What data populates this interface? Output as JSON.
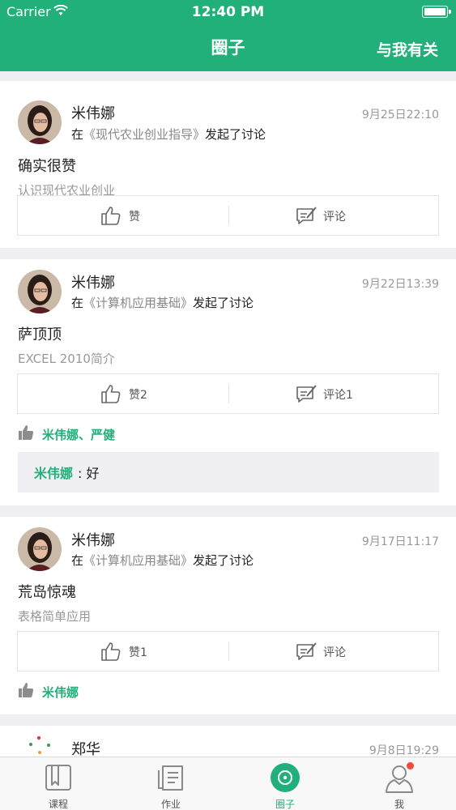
{
  "status_bar": {
    "carrier": "Carrier",
    "time": "12:40 PM"
  },
  "nav": {
    "title": "圈子",
    "right_label": "与我有关"
  },
  "colors": {
    "accent": "#22b07a",
    "badge": "#f44b3c",
    "background": "#efeff4"
  },
  "posts": [
    {
      "author": "米伟娜",
      "time": "9月25日22:10",
      "desc_prefix": "在",
      "course": "《现代农业创业指导》",
      "desc_suffix": "发起了讨论",
      "title": "确实很赞",
      "subtitle": "认识现代农业创业",
      "like_label": "赞",
      "comment_label": "评论"
    },
    {
      "author": "米伟娜",
      "time": "9月22日13:39",
      "desc_prefix": "在",
      "course": "《计算机应用基础》",
      "desc_suffix": "发起了讨论",
      "title": "萨顶顶",
      "subtitle": "EXCEL 2010简介",
      "like_label": "赞2",
      "comment_label": "评论1",
      "likers": "米伟娜、严健",
      "comment": {
        "author": "米伟娜",
        "text": ": 好"
      }
    },
    {
      "author": "米伟娜",
      "time": "9月17日11:17",
      "desc_prefix": "在",
      "course": "《计算机应用基础》",
      "desc_suffix": "发起了讨论",
      "title": "荒岛惊魂",
      "subtitle": "表格简单应用",
      "like_label": "赞1",
      "comment_label": "评论",
      "likers": "米伟娜"
    },
    {
      "author": "郑华",
      "time": "9月8日19:29"
    }
  ],
  "tabs": [
    {
      "label": "课程",
      "icon": "book-icon"
    },
    {
      "label": "作业",
      "icon": "document-icon"
    },
    {
      "label": "圈子",
      "icon": "circle-icon",
      "active": true
    },
    {
      "label": "我",
      "icon": "person-icon",
      "badge": true
    }
  ]
}
